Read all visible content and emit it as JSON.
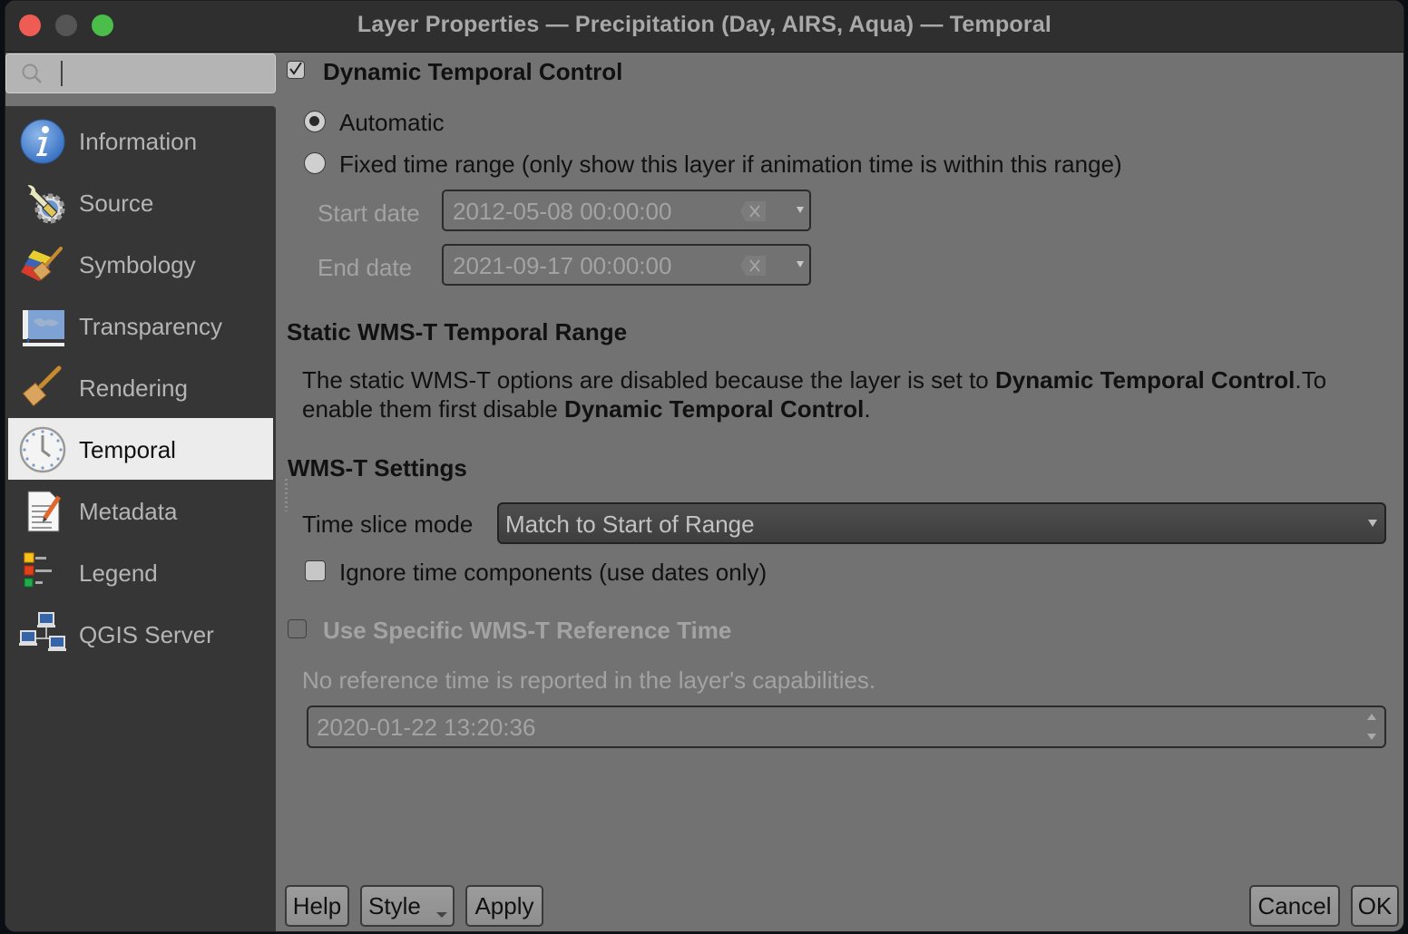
{
  "window": {
    "title": "Layer Properties — Precipitation (Day, AIRS, Aqua) — Temporal",
    "controls": [
      "close",
      "minimize",
      "maximize"
    ]
  },
  "sidebar": {
    "search": {
      "value": "",
      "placeholder": ""
    },
    "items": [
      {
        "label": "Information",
        "icon": "information-icon",
        "active": false
      },
      {
        "label": "Source",
        "icon": "source-wrench-gear-icon",
        "active": false
      },
      {
        "label": "Symbology",
        "icon": "symbology-paintbrush-icon",
        "active": false
      },
      {
        "label": "Transparency",
        "icon": "transparency-map-icon",
        "active": false
      },
      {
        "label": "Rendering",
        "icon": "rendering-brush-icon",
        "active": false
      },
      {
        "label": "Temporal",
        "icon": "temporal-clock-icon",
        "active": true
      },
      {
        "label": "Metadata",
        "icon": "metadata-document-icon",
        "active": false
      },
      {
        "label": "Legend",
        "icon": "legend-icon",
        "active": false
      },
      {
        "label": "QGIS Server",
        "icon": "qgis-server-network-icon",
        "active": false
      }
    ]
  },
  "temporal": {
    "dynamic_control": {
      "label": "Dynamic Temporal Control",
      "checked": true
    },
    "mode_options": [
      {
        "label": "Automatic",
        "selected": true
      },
      {
        "label": "Fixed time range (only show this layer if animation time is within this range)",
        "selected": false
      }
    ],
    "start_date": {
      "label": "Start date",
      "value": "2012-05-08 00:00:00",
      "enabled": false
    },
    "end_date": {
      "label": "End date",
      "value": "2021-09-17 00:00:00",
      "enabled": false
    },
    "static_section": {
      "heading": "Static WMS-T Temporal Range",
      "message_part1": "The static WMS-T options are disabled because the layer is set to ",
      "message_bold1": "Dynamic Temporal Control",
      "message_part2": ".To",
      "message_part3": "enable them first disable ",
      "message_bold2": "Dynamic Temporal Control",
      "message_part4": "."
    },
    "wmst_settings": {
      "heading": "WMS-T Settings",
      "time_slice_label": "Time slice mode",
      "time_slice_value": "Match to Start of Range",
      "ignore_time": {
        "label": "Ignore time components (use dates only)",
        "checked": false
      }
    },
    "reference_time": {
      "label": "Use Specific WMS-T Reference Time",
      "checked": false,
      "enabled": false,
      "note": "No reference time is reported in the layer's capabilities.",
      "value": "2020-01-22 13:20:36"
    }
  },
  "buttons": {
    "help": "Help",
    "style": "Style",
    "apply": "Apply",
    "cancel": "Cancel",
    "ok": "OK"
  }
}
